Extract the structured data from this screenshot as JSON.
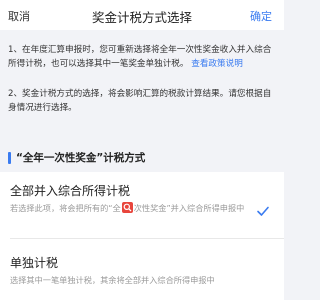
{
  "header": {
    "cancel_label": "取消",
    "title": "奖金计税方式选择",
    "confirm_label": "确定"
  },
  "notice": {
    "line1_text": "1、在年度汇算申报时，您可重新选择将全年一次性奖金收入并入综合所得计税，也可以选择其中一笔奖金单独计税。",
    "line1_link": "查看政策说明",
    "line2_text": "2、奖金计税方式的选择，将会影响汇算的税款计算结果。请您根据自身情况进行选择。"
  },
  "section": {
    "label": "“全年一次性奖金”计税方式"
  },
  "options": [
    {
      "name": "全部并入综合所得计税",
      "desc_before": "若选择此项，将会把所有的“全",
      "desc_after": "次性奖金”并入综合所得申报中",
      "selected": true
    },
    {
      "name": "单独计税",
      "desc": "选择其中一笔单独计税，其余将全部并入综合所得申报中",
      "selected": false
    }
  ],
  "colors": {
    "accent": "#3a7bf0",
    "badge": "#e8453c"
  },
  "icons": {
    "selected_check": "check-icon",
    "overlay": "search-icon"
  }
}
